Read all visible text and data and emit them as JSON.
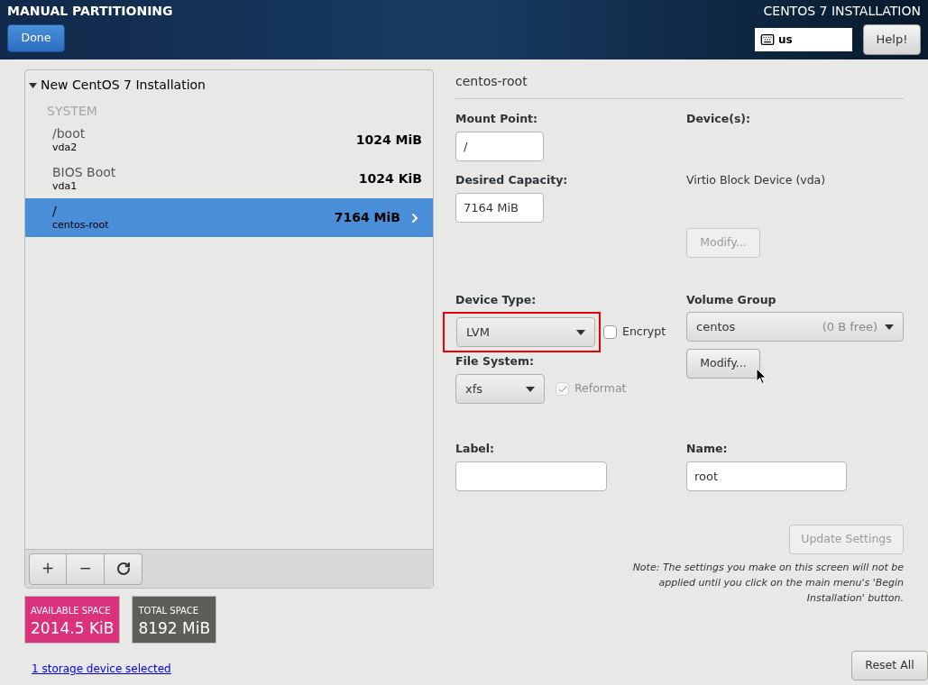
{
  "header": {
    "title": "MANUAL PARTITIONING",
    "product": "CENTOS 7 INSTALLATION",
    "done_button": "Done",
    "keyboard_layout": "us",
    "help_button": "Help!"
  },
  "partition_tree": {
    "title": "New CentOS 7 Installation",
    "expanded": true,
    "group": "SYSTEM",
    "items": [
      {
        "mount": "/boot",
        "device": "vda2",
        "size": "1024 MiB",
        "selected": false
      },
      {
        "mount": "BIOS Boot",
        "device": "vda1",
        "size": "1024 KiB",
        "selected": false
      },
      {
        "mount": "/",
        "device": "centos-root",
        "size": "7164 MiB",
        "selected": true
      }
    ],
    "toolbar": [
      {
        "kind": "add",
        "label": "+"
      },
      {
        "kind": "remove",
        "label": "−"
      },
      {
        "kind": "refresh"
      }
    ]
  },
  "space": [
    {
      "label": "AVAILABLE SPACE",
      "value": "2014.5 KiB",
      "color": "#dc317b"
    },
    {
      "label": "TOTAL SPACE",
      "value": "8192 MiB",
      "color": "#5d5e58"
    }
  ],
  "storage_link": "1 storage device selected",
  "details": {
    "title": "centos-root",
    "mount_point": {
      "label": "Mount Point:",
      "value": "/"
    },
    "desired_capacity": {
      "label": "Desired Capacity:",
      "value": "7164 MiB"
    },
    "devices": {
      "label": "Device(s):",
      "value": "Virtio Block Device (vda)",
      "modify_button": "Modify...",
      "modify_disabled": true
    },
    "device_type": {
      "label": "Device Type:",
      "value": "LVM",
      "highlighted": true
    },
    "encrypt": {
      "label": "Encrypt",
      "checked": false,
      "disabled": false
    },
    "file_system": {
      "label": "File System:",
      "value": "xfs"
    },
    "reformat": {
      "label": "Reformat",
      "checked": true,
      "disabled": true
    },
    "volume_group": {
      "label": "Volume Group",
      "value": "centos",
      "free": "(0 B free)",
      "modify_button": "Modify...",
      "modify_disabled": false
    },
    "label_field": {
      "label": "Label:"
    },
    "name_field": {
      "label": "Name:",
      "value": "root"
    },
    "update_button": {
      "label": "Update Settings",
      "disabled": true
    },
    "note": "Note:  The settings you make on this screen will not be applied until you click on the main menu's 'Begin Installation' button."
  },
  "reset_button": "Reset All"
}
